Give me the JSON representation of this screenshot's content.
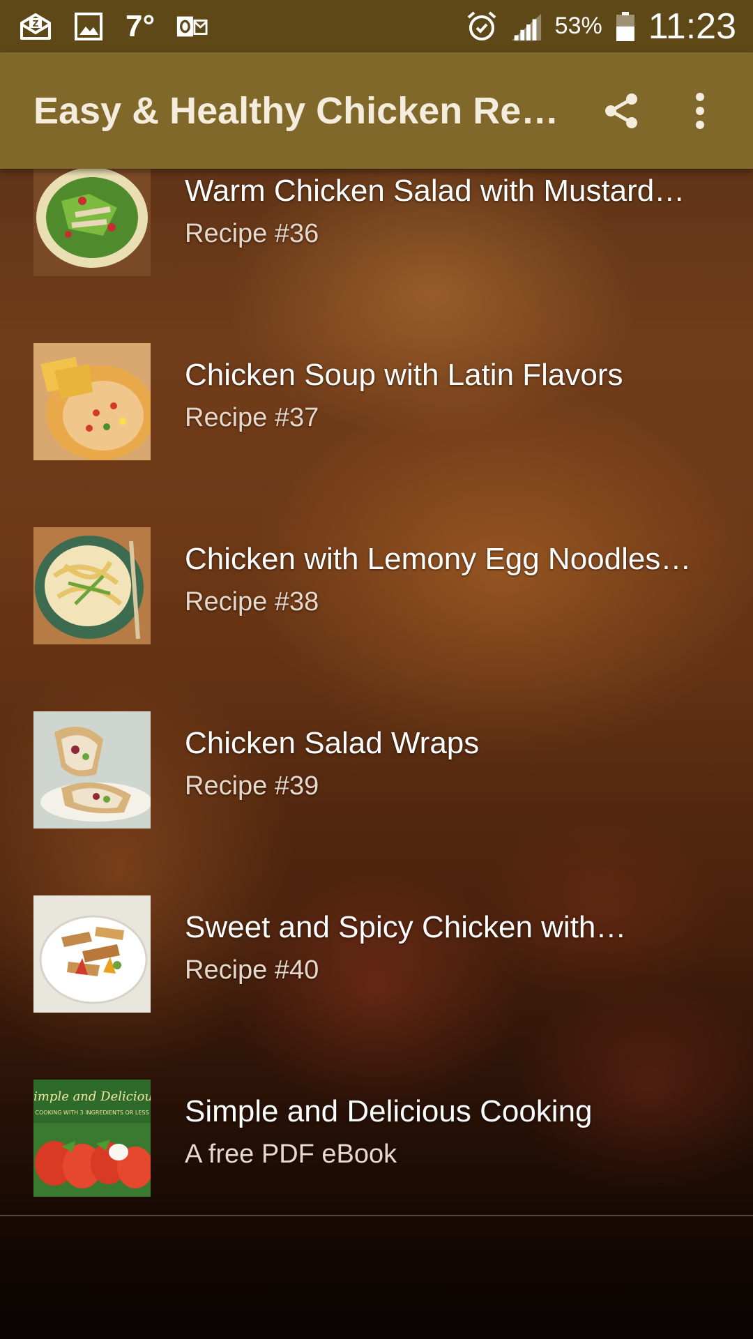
{
  "status_bar": {
    "icons_left": [
      "mail-icon",
      "gallery-icon",
      "outlook-icon"
    ],
    "temperature": "7°",
    "battery": "53%",
    "time": "11:23",
    "icons_right": [
      "alarm-icon",
      "signal-icon",
      "battery-icon"
    ]
  },
  "app_bar": {
    "title": "Easy & Healthy Chicken Re…",
    "actions": [
      "share-icon",
      "more-vert-icon"
    ]
  },
  "items": [
    {
      "title": "Warm Chicken Salad with Mustard…",
      "subtitle": "Recipe #36",
      "thumb": "salad"
    },
    {
      "title": "Chicken Soup with Latin Flavors",
      "subtitle": "Recipe #37",
      "thumb": "soup"
    },
    {
      "title": "Chicken with Lemony Egg Noodles…",
      "subtitle": "Recipe #38",
      "thumb": "noodles"
    },
    {
      "title": "Chicken Salad Wraps",
      "subtitle": "Recipe #39",
      "thumb": "wraps"
    },
    {
      "title": "Sweet and Spicy Chicken with…",
      "subtitle": "Recipe #40",
      "thumb": "spicy"
    },
    {
      "title": "Simple and Delicious Cooking",
      "subtitle": "A free PDF eBook",
      "thumb": "ebook",
      "thumb_text_1": "Simple and Delicious",
      "thumb_text_2": "COOKING WITH 3 INGREDIENTS OR LESS"
    }
  ],
  "colors": {
    "status_bar": "#5e4818",
    "app_bar": "#80672a",
    "title_text": "#f4ecdc"
  }
}
